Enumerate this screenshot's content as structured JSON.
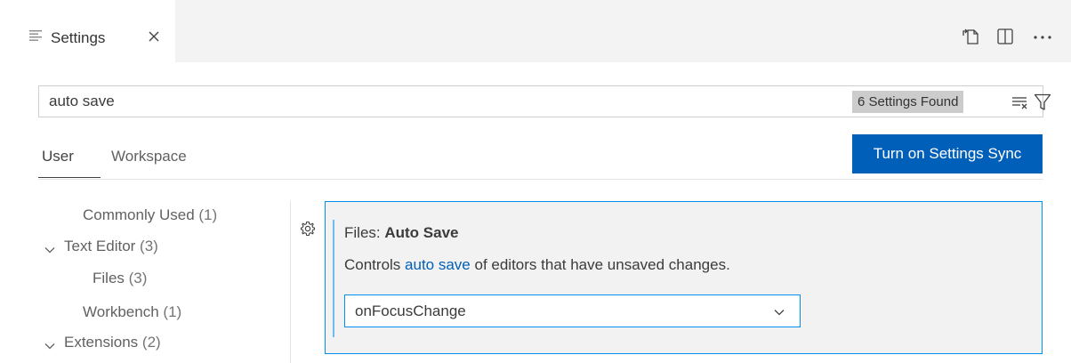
{
  "tab": {
    "title": "Settings",
    "icon": "settings-editor-icon",
    "close_icon": "close-icon"
  },
  "editor_actions": [
    {
      "name": "open-settings-json",
      "icon": "open-json-icon"
    },
    {
      "name": "split-editor",
      "icon": "split-editor-icon"
    },
    {
      "name": "more-actions",
      "icon": "ellipsis-icon"
    }
  ],
  "search": {
    "value": "auto save",
    "results_label": "6 Settings Found",
    "clear_icon": "clear-filter-icon",
    "filter_icon": "filter-icon"
  },
  "scopes": {
    "user": "User",
    "workspace": "Workspace",
    "active": "User"
  },
  "sync_button": "Turn on Settings Sync",
  "toc": [
    {
      "label": "Commonly Used",
      "count": "(1)",
      "expandable": false
    },
    {
      "label": "Text Editor",
      "count": "(3)",
      "expandable": true,
      "expanded": true
    },
    {
      "label": "Files",
      "count": "(3)",
      "expandable": false
    },
    {
      "label": "Workbench",
      "count": "(1)",
      "expandable": false
    },
    {
      "label": "Extensions",
      "count": "(2)",
      "expandable": true,
      "expanded": true
    }
  ],
  "setting": {
    "category": "Files: ",
    "name": "Auto Save",
    "description_before": "Controls ",
    "description_link": "auto save",
    "description_after": " of editors that have unsaved changes.",
    "value": "onFocusChange",
    "gear_icon": "gear-icon",
    "dropdown_icon": "chevron-down-icon"
  },
  "colors": {
    "accent": "#005fb8",
    "focus_border": "#0090f1",
    "badge_bg": "#cccccc"
  }
}
